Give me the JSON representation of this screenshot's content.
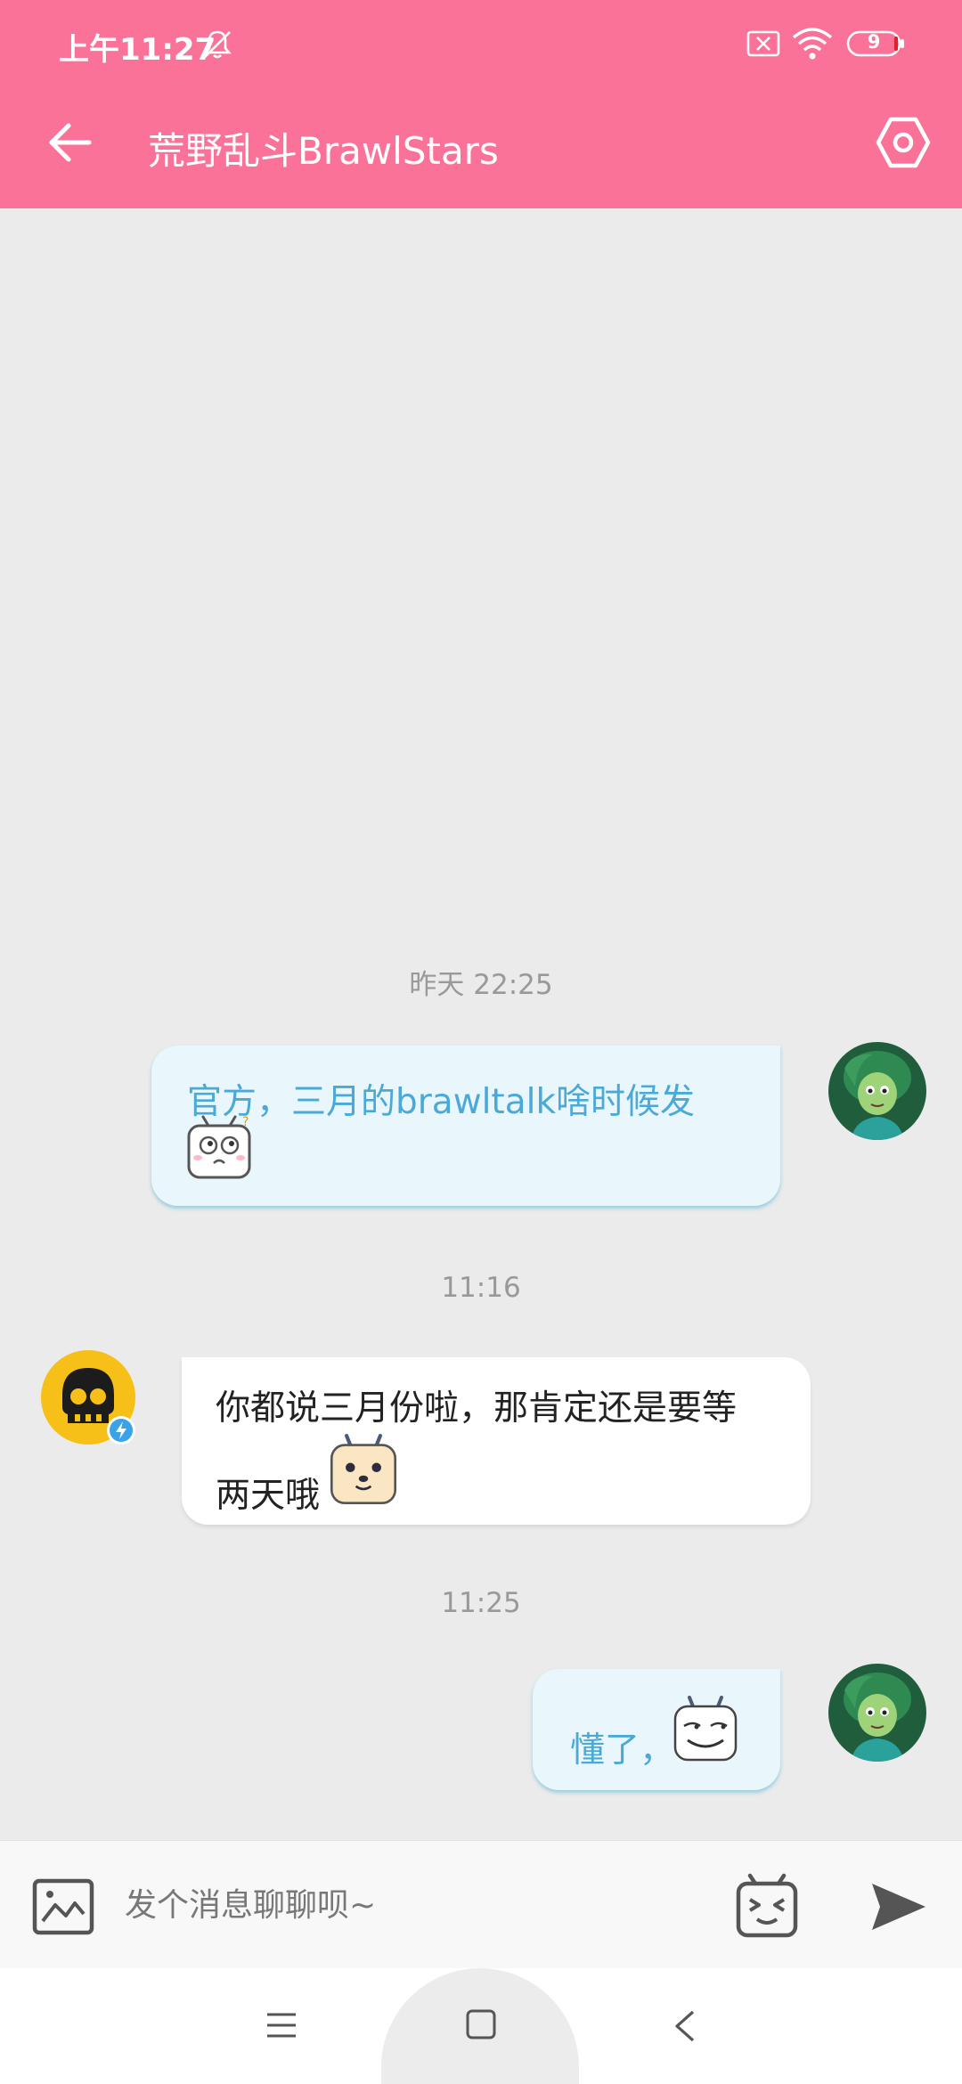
{
  "status_bar": {
    "time": "上午11:27",
    "battery_level": "9"
  },
  "header": {
    "title": "荒野乱斗BrawlStars"
  },
  "chat": {
    "messages": [
      {
        "timestamp": "昨天 22:25",
        "sender": "me",
        "text": "官方，三月的brawltalk啥时候发",
        "emoji": "bilibili-tv-emoji"
      },
      {
        "timestamp": "11:16",
        "sender": "other",
        "line1": "你都说三月份啦，那肯定还是要等",
        "line2": "两天哦",
        "emoji": "bilibili-tv-emoji"
      },
      {
        "timestamp": "11:25",
        "sender": "me",
        "text": "懂了，",
        "emoji": "bilibili-tv-emoji"
      }
    ]
  },
  "input": {
    "placeholder": "发个消息聊聊呗~"
  },
  "colors": {
    "brand_pink": "#fb7299",
    "mine_bubble": "#e9f7fd",
    "mine_text": "#4aa9d6"
  }
}
